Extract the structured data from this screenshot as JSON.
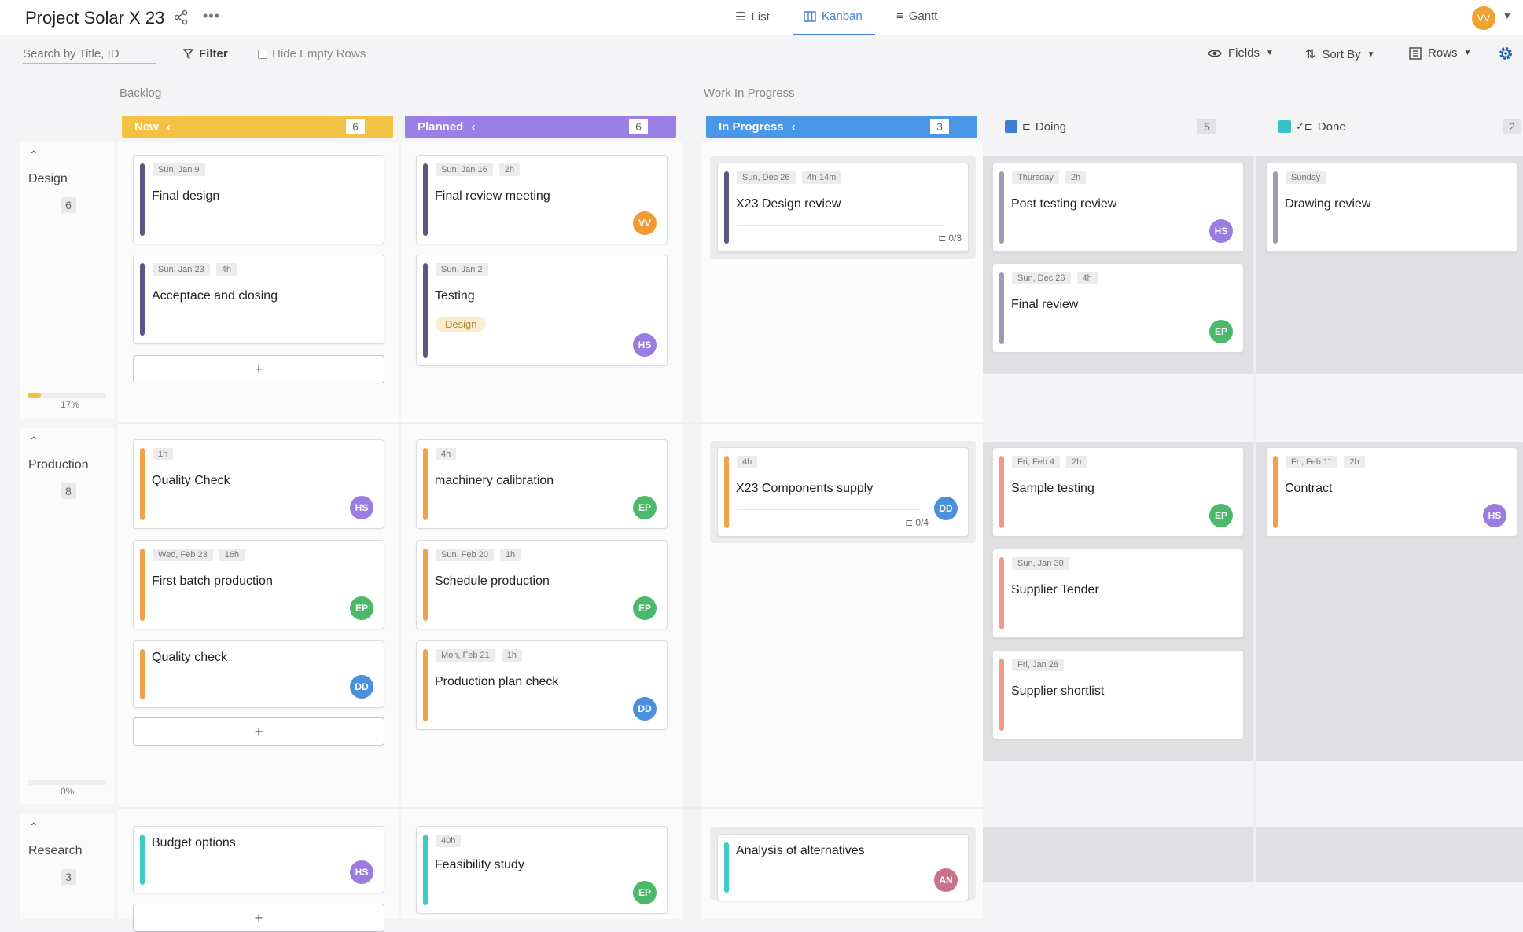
{
  "header": {
    "project_title": "Project Solar X 23",
    "tabs": [
      {
        "label": "List",
        "icon": "list-icon"
      },
      {
        "label": "Kanban",
        "icon": "kanban-icon"
      },
      {
        "label": "Gantt",
        "icon": "gantt-icon"
      }
    ],
    "active_tab": "Kanban",
    "user_initials": "VV"
  },
  "toolbar": {
    "search_placeholder": "Search by Title, ID",
    "filter_label": "Filter",
    "hide_empty_label": "Hide Empty Rows",
    "fields_label": "Fields",
    "sort_label": "Sort By",
    "rows_label": "Rows"
  },
  "groups": {
    "backlog": "Backlog",
    "wip": "Work In Progress"
  },
  "columns": [
    {
      "name": "New",
      "count": "6",
      "color": "#f3c244"
    },
    {
      "name": "Planned",
      "count": "6",
      "color": "#9b7ee6"
    },
    {
      "name": "In Progress",
      "count": "3",
      "color": "#4a97e8"
    },
    {
      "name": "Doing",
      "count": "5",
      "color": "#3d7fd6"
    },
    {
      "name": "Done",
      "count": "2",
      "color": "#34c3c9"
    }
  ],
  "rows": [
    {
      "name": "Design",
      "count": "6",
      "progress_label": "17%",
      "progress": 0.17,
      "accent": "#5c5686"
    },
    {
      "name": "Production",
      "count": "8",
      "progress_label": "0%",
      "progress": 0,
      "accent": "#f0a24a"
    },
    {
      "name": "Research",
      "count": "3",
      "accent": "#3ccbc6"
    }
  ],
  "cards": {
    "design_new_1": {
      "tags": [
        "Sun, Jan 9"
      ],
      "title": "Final design"
    },
    "design_new_2": {
      "tags": [
        "Sun, Jan 23",
        "4h"
      ],
      "title": "Acceptace and closing"
    },
    "design_planned_1": {
      "tags": [
        "Sun, Jan 16",
        "2h"
      ],
      "title": "Final review meeting",
      "avatar": "VV"
    },
    "design_planned_2": {
      "tags": [
        "Sun, Jan 2"
      ],
      "title": "Testing",
      "label": "Design",
      "avatar": "HS"
    },
    "design_inprogress_1": {
      "tags": [
        "Sun, Dec 26",
        "4h 14m"
      ],
      "title": "X23 Design review",
      "subtasks": "0/3"
    },
    "design_doing_1": {
      "tags": [
        "Thursday",
        "2h"
      ],
      "title": "Post testing review",
      "avatar": "HS"
    },
    "design_doing_2": {
      "tags": [
        "Sun, Dec 26",
        "4h"
      ],
      "title": "Final review",
      "avatar": "EP"
    },
    "design_done_1": {
      "tags": [
        "Sunday"
      ],
      "title": "Drawing review"
    },
    "prod_new_1": {
      "tags": [
        "1h"
      ],
      "title": "Quality Check",
      "avatar": "HS"
    },
    "prod_new_2": {
      "tags": [
        "Wed, Feb 23",
        "16h"
      ],
      "title": "First batch production",
      "avatar": "EP"
    },
    "prod_new_3": {
      "title": "Quality check",
      "avatar": "DD"
    },
    "prod_planned_1": {
      "tags": [
        "4h"
      ],
      "title": "machinery calibration",
      "avatar": "EP"
    },
    "prod_planned_2": {
      "tags": [
        "Sun, Feb 20",
        "1h"
      ],
      "title": "Schedule production",
      "avatar": "EP"
    },
    "prod_planned_3": {
      "tags": [
        "Mon, Feb 21",
        "1h"
      ],
      "title": "Production plan check",
      "avatar": "DD"
    },
    "prod_inprogress_1": {
      "tags": [
        "4h"
      ],
      "title": "X23 Components supply",
      "subtasks": "0/4",
      "avatar": "DD"
    },
    "prod_doing_1": {
      "tags": [
        "Fri, Feb 4",
        "2h"
      ],
      "title": "Sample testing",
      "avatar": "EP"
    },
    "prod_doing_2": {
      "tags": [
        "Sun, Jan 30"
      ],
      "title": "Supplier Tender"
    },
    "prod_doing_3": {
      "tags": [
        "Fri, Jan 28"
      ],
      "title": "Supplier shortlist"
    },
    "prod_done_1": {
      "tags": [
        "Fri, Feb 11",
        "2h"
      ],
      "title": "Contract",
      "avatar": "HS"
    },
    "res_new_1": {
      "title": "Budget options",
      "avatar": "HS"
    },
    "res_planned_1": {
      "tags": [
        "40h"
      ],
      "title": "Feasibility study",
      "avatar": "EP"
    },
    "res_inprogress_1": {
      "title": "Analysis of alternatives",
      "avatar": "AN"
    }
  },
  "add_label": "+",
  "colors": {
    "avatar_VV": "#f09a35",
    "avatar_HS": "#9c7ce0",
    "avatar_EP": "#4cb86a",
    "avatar_DD": "#4a90dc",
    "avatar_AN": "#c8738a",
    "doing_bar": "#9c9cb0",
    "prod_doing_bar": "#f39a82"
  }
}
